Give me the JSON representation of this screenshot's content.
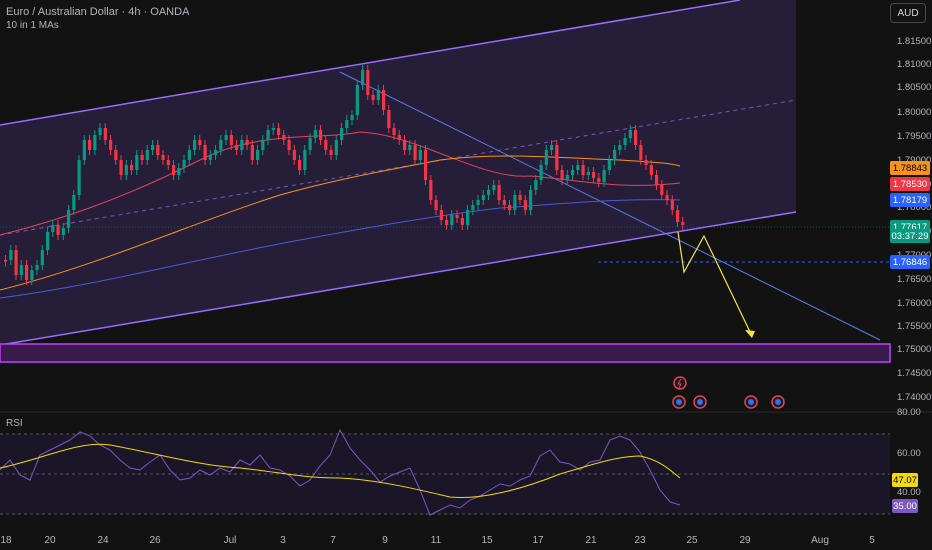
{
  "header": {
    "title": "Euro / Australian Dollar · 4h · OANDA",
    "indicator": "10 in 1 MAs",
    "currency_button": "AUD"
  },
  "price_axis": {
    "ticks": [
      "1.81500",
      "1.81000",
      "1.80500",
      "1.80000",
      "1.79500",
      "1.79000",
      "1.78500",
      "1.78000",
      "1.77500",
      "1.77000",
      "1.76500",
      "1.76000",
      "1.75500",
      "1.75000",
      "1.74500",
      "1.74000"
    ],
    "badges": [
      {
        "value": "1.78843",
        "color": "#f7931a",
        "text_color": "#000000"
      },
      {
        "value": "1.78530",
        "color": "#f23645",
        "text_color": "#ffffff"
      },
      {
        "value": "1.78179",
        "color": "#2962ff",
        "text_color": "#ffffff"
      },
      {
        "value": "1.77617",
        "color": "#089981",
        "text_color": "#ffffff"
      },
      {
        "value": "03:37:29",
        "color": "#089981",
        "text_color": "#ffffff"
      },
      {
        "value": "1.76846",
        "color": "#2962ff",
        "text_color": "#ffffff"
      }
    ]
  },
  "rsi": {
    "name": "RSI",
    "ticks": [
      "80.00",
      "60.00",
      "40.00"
    ],
    "badges": [
      {
        "value": "47.07",
        "color": "#f5d90a",
        "text_color": "#000000"
      },
      {
        "value": "35.00",
        "color": "#7e57c2",
        "text_color": "#ffffff"
      }
    ]
  },
  "time_axis": {
    "labels": [
      "18",
      "20",
      "24",
      "26",
      "Jul",
      "3",
      "7",
      "9",
      "11",
      "15",
      "17",
      "21",
      "23",
      "25",
      "29",
      "Aug",
      "5"
    ]
  },
  "colors": {
    "background": "#121212",
    "up": "#089981",
    "down": "#f23645",
    "channel": "#9b6cff",
    "ma_fast": "#e0455a",
    "ma_mid": "#f7931a",
    "ma_slow": "#4a5bd8",
    "projection": "#f5e642",
    "rsi_line": "#7e57c2",
    "rsi_ma": "#f5d90a"
  },
  "events": {
    "icons": [
      "lightning-icon",
      "flag-icon",
      "flag-icon",
      "flag-icon",
      "flag-icon"
    ]
  }
}
